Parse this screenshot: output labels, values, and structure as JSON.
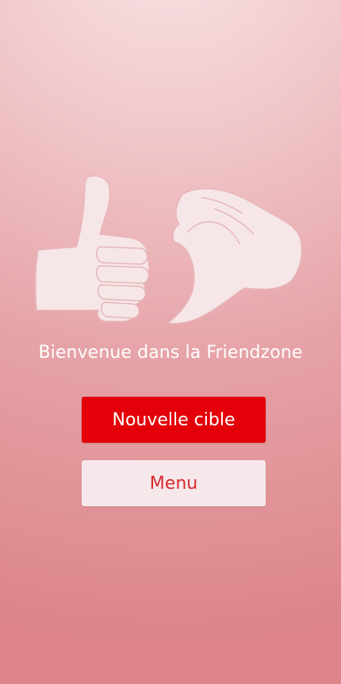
{
  "app": {
    "logo_icon": "thumbs-up-and-heart-hand-icon",
    "welcome_text": "Bienvenue dans la Friendzone"
  },
  "actions": {
    "new_target_label": "Nouvelle cible",
    "menu_label": "Menu"
  },
  "colors": {
    "primary_button": "#e30008",
    "secondary_button": "#f6e8ea",
    "secondary_text": "#d62a2f",
    "logo_fill": "#f6e6e7"
  }
}
